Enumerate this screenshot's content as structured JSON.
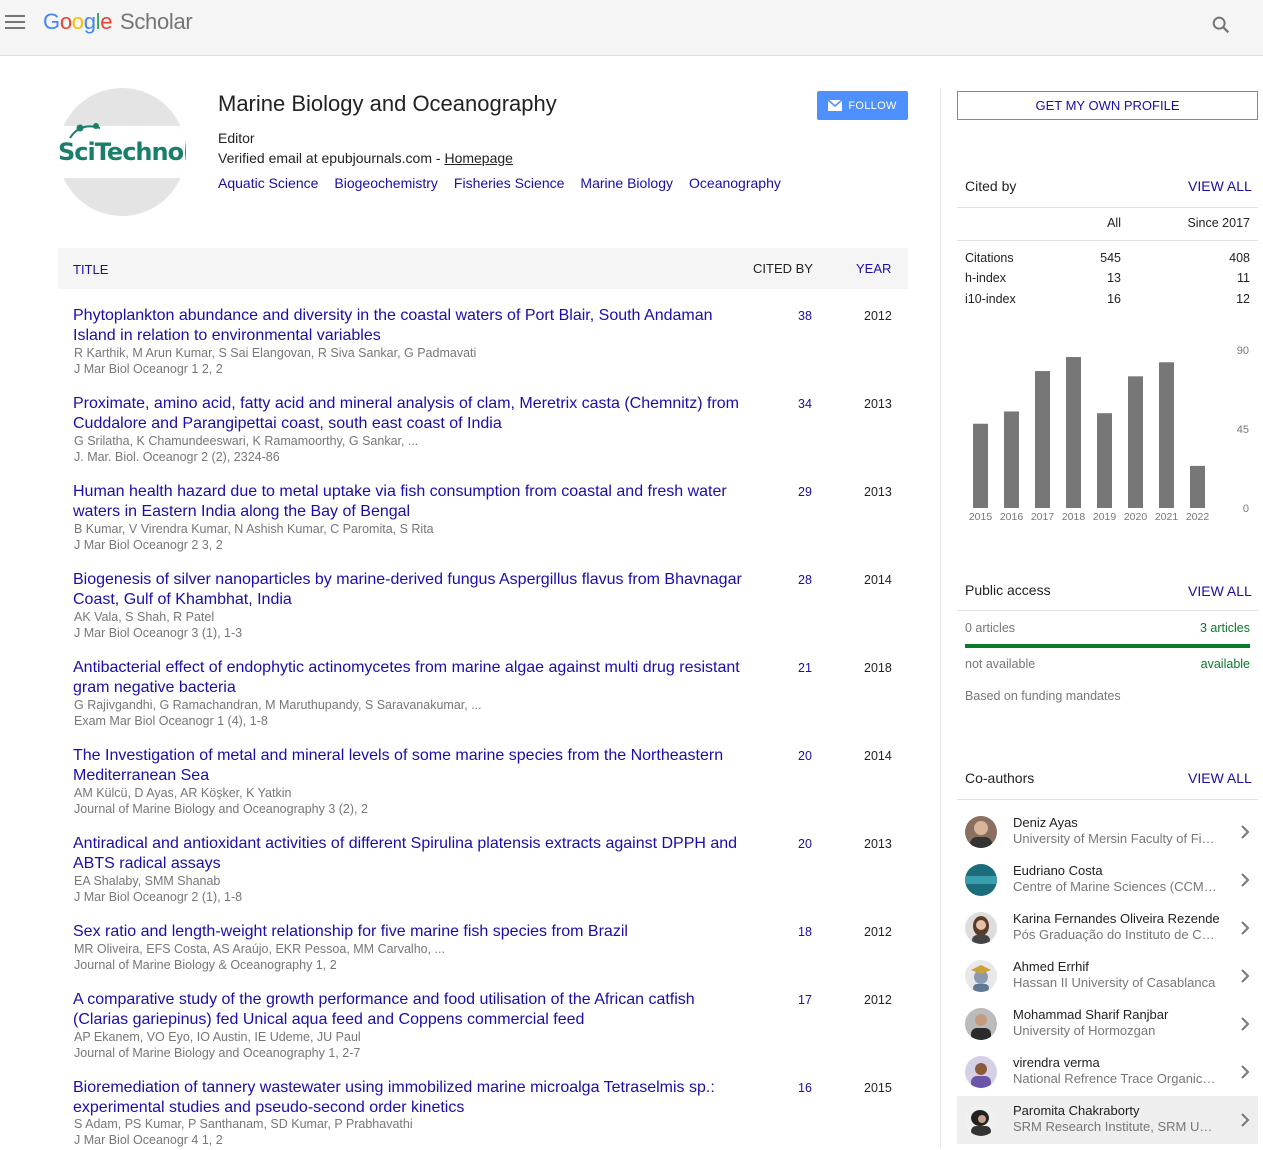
{
  "header": {
    "logo_google": "Google",
    "logo_scholar": "Scholar"
  },
  "profile": {
    "name": "Marine Biology and Oceanography",
    "role": "Editor",
    "email_prefix": "Verified email at epubjournals.com - ",
    "homepage": "Homepage",
    "avatar_text": "SciTechnol",
    "follow_label": "FOLLOW",
    "interests": [
      "Aquatic Science",
      "Biogeochemistry",
      "Fisheries Science",
      "Marine Biology",
      "Oceanography"
    ]
  },
  "table": {
    "col_title": "TITLE",
    "col_cited": "CITED BY",
    "col_year": "YEAR",
    "rows": [
      {
        "title": "Phytoplankton abundance and diversity in the coastal waters of Port Blair, South Andaman Island in relation to environmental variables",
        "authors": "R Karthik, M Arun Kumar, S Sai Elangovan, R Siva Sankar, G Padmavati",
        "venue": "J Mar Biol Oceanogr 1 2, 2",
        "cited": "38",
        "year": "2012"
      },
      {
        "title": "Proximate, amino acid, fatty acid and mineral analysis of clam, Meretrix casta (Chemnitz) from Cuddalore and Parangipettai coast, south east coast of India",
        "authors": "G Srilatha, K Chamundeeswari, K Ramamoorthy, G Sankar, ...",
        "venue": "J. Mar. Biol. Oceanogr 2 (2), 2324-86",
        "cited": "34",
        "year": "2013"
      },
      {
        "title": "Human health hazard due to metal uptake via fish consumption from coastal and fresh water waters in Eastern India along the Bay of Bengal",
        "authors": "B Kumar, V Virendra Kumar, N Ashish Kumar, C Paromita, S Rita",
        "venue": "J Mar Biol Oceanogr 2 3, 2",
        "cited": "29",
        "year": "2013"
      },
      {
        "title": "Biogenesis of silver nanoparticles by marine-derived fungus Aspergillus flavus from Bhavnagar Coast, Gulf of Khambhat, India",
        "authors": "AK Vala, S Shah, R Patel",
        "venue": "J Mar Biol Oceanogr 3 (1), 1-3",
        "cited": "28",
        "year": "2014"
      },
      {
        "title": "Antibacterial effect of endophytic actinomycetes from marine algae against multi drug resistant gram negative bacteria",
        "authors": "G Rajivgandhi, G Ramachandran, M Maruthupandy, S Saravanakumar, ...",
        "venue": "Exam Mar Biol Oceanogr 1 (4), 1-8",
        "cited": "21",
        "year": "2018"
      },
      {
        "title": "The Investigation of metal and mineral levels of some marine species from the Northeastern Mediterranean Sea",
        "authors": "AM Külcü, D Ayas, AR Köşker, K Yatkin",
        "venue": "Journal of Marine Biology and Oceanography 3 (2), 2",
        "cited": "20",
        "year": "2014"
      },
      {
        "title": "Antiradical and antioxidant activities of different Spirulina platensis extracts against DPPH and ABTS radical assays",
        "authors": "EA Shalaby, SMM Shanab",
        "venue": "J Mar Biol Oceanogr 2 (1), 1-8",
        "cited": "20",
        "year": "2013"
      },
      {
        "title": "Sex ratio and length-weight relationship for five marine fish species from Brazil",
        "authors": "MR Oliveira, EFS Costa, AS Araújo, EKR Pessoa, MM Carvalho, ...",
        "venue": "Journal of Marine Biology & Oceanography 1, 2",
        "cited": "18",
        "year": "2012"
      },
      {
        "title": "A comparative study of the growth performance and food utilisation of the African catfish (Clarias gariepinus) fed Unical aqua feed and Coppens commercial feed",
        "authors": "AP Ekanem, VO Eyo, IO Austin, IE Udeme, JU Paul",
        "venue": "Journal of Marine Biology and Oceanography 1, 2-7",
        "cited": "17",
        "year": "2012"
      },
      {
        "title": "Bioremediation of tannery wastewater using immobilized marine microalga Tetraselmis sp.: experimental studies and pseudo-second order kinetics",
        "authors": "S Adam, PS Kumar, P Santhanam, SD Kumar, P Prabhavathi",
        "venue": "J Mar Biol Oceanogr 4 1, 2",
        "cited": "16",
        "year": "2015"
      }
    ]
  },
  "sidebar": {
    "own_profile": "GET MY OWN PROFILE",
    "view_all": "VIEW ALL",
    "cited_by": {
      "title": "Cited by",
      "col_all": "All",
      "col_since": "Since 2017",
      "rows": [
        {
          "label": "Citations",
          "all": "545",
          "since": "408"
        },
        {
          "label": "h-index",
          "all": "13",
          "since": "11"
        },
        {
          "label": "i10-index",
          "all": "16",
          "since": "12"
        }
      ]
    },
    "public_access": {
      "title": "Public access",
      "left_count": "0 articles",
      "right_count": "3 articles",
      "left_status": "not available",
      "right_status": "available",
      "note": "Based on funding mandates"
    },
    "coauthors": {
      "title": "Co-authors",
      "items": [
        {
          "name": "Deniz Ayas",
          "aff": "University of Mersin Faculty of Fisheries"
        },
        {
          "name": "Eudriano Costa",
          "aff": "Centre of Marine Sciences (CCMAR)"
        },
        {
          "name": "Karina Fernandes Oliveira Rezende",
          "aff": "Pós Graduação do Instituto de Ciências"
        },
        {
          "name": "Ahmed Errhif",
          "aff": "Hassan II University of Casablanca"
        },
        {
          "name": "Mohammad Sharif Ranjbar",
          "aff": "University of Hormozgan"
        },
        {
          "name": "virendra verma",
          "aff": "National Refrence Trace Organics Laboratory"
        },
        {
          "name": "Paromita Chakraborty",
          "aff": "SRM Research Institute, SRM University"
        }
      ]
    }
  },
  "chart_data": {
    "type": "bar",
    "categories": [
      "2015",
      "2016",
      "2017",
      "2018",
      "2019",
      "2020",
      "2021",
      "2022"
    ],
    "values": [
      48,
      55,
      78,
      86,
      54,
      75,
      83,
      24
    ],
    "ylim": [
      0,
      90
    ],
    "yticks": [
      "90",
      "45",
      "0"
    ],
    "bar_color": "#777777"
  }
}
